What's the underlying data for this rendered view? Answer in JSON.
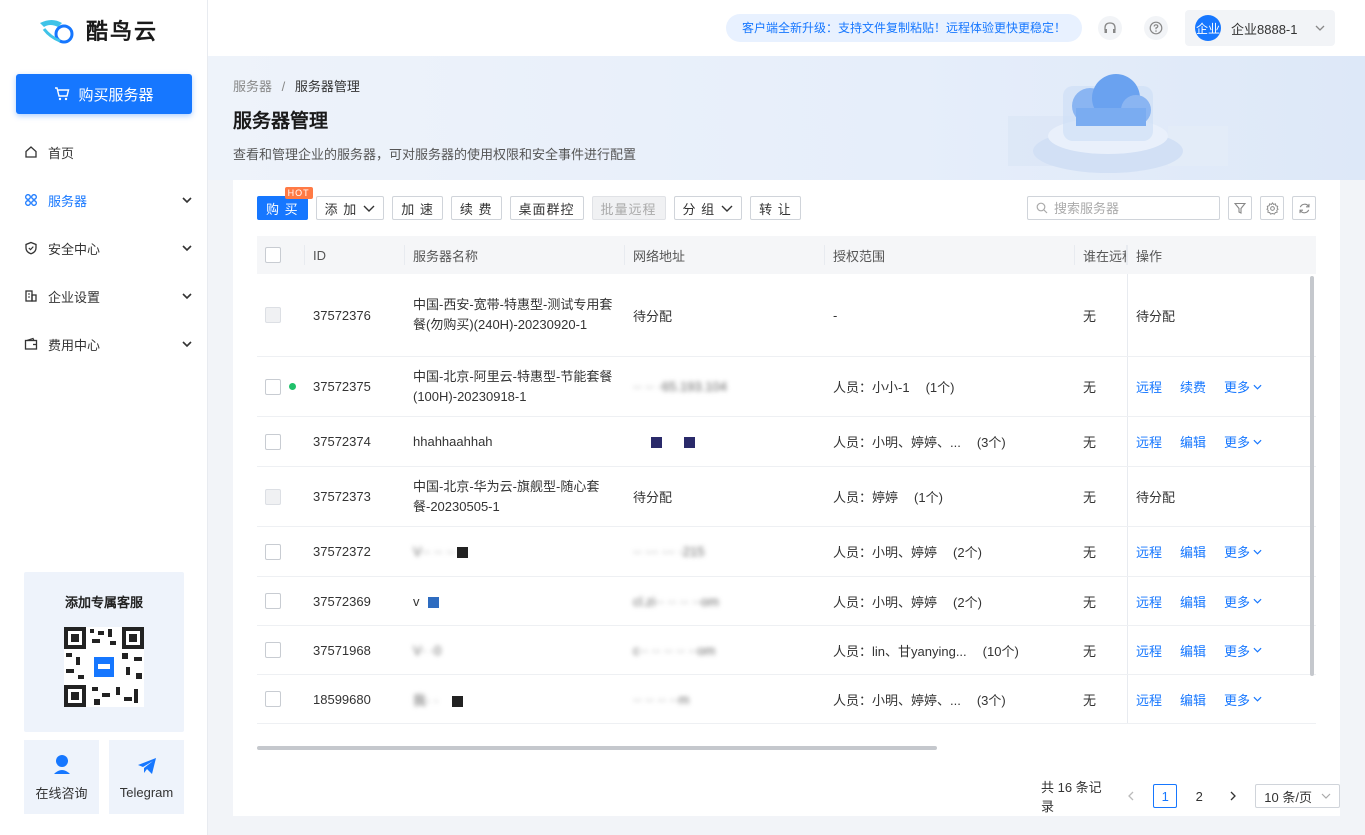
{
  "app": {
    "logo_text": "酷鸟云"
  },
  "sidebar": {
    "buy_button": "购买服务器",
    "items": [
      {
        "label": "首页",
        "icon": "home-icon",
        "expandable": false,
        "active": false
      },
      {
        "label": "服务器",
        "icon": "server-grid-icon",
        "expandable": true,
        "active": true
      },
      {
        "label": "安全中心",
        "icon": "shield-icon",
        "expandable": true,
        "active": false
      },
      {
        "label": "企业设置",
        "icon": "building-icon",
        "expandable": true,
        "active": false
      },
      {
        "label": "费用中心",
        "icon": "wallet-icon",
        "expandable": true,
        "active": false
      }
    ],
    "service_card_title": "添加专属客服",
    "online_consult": "在线咨询",
    "telegram": "Telegram"
  },
  "topbar": {
    "notice": "客户端全新升级：支持文件复制粘贴！远程体验更快更稳定！",
    "avatar_text": "企业",
    "user_name": "企业8888-1"
  },
  "header": {
    "breadcrumb_root": "服务器",
    "breadcrumb_sep": "/",
    "breadcrumb_current": "服务器管理",
    "title": "服务器管理",
    "description": "查看和管理企业的服务器，可对服务器的使用权限和安全事件进行配置"
  },
  "toolbar": {
    "buy": "购 买",
    "hot": "HOT",
    "add": "添 加",
    "accelerate": "加 速",
    "renew": "续 费",
    "desktop_control": "桌面群控",
    "batch_remote": "批量远程",
    "group": "分 组",
    "transfer": "转 让",
    "search_placeholder": "搜索服务器"
  },
  "table": {
    "headers": {
      "id": "ID",
      "name": "服务器名称",
      "network": "网络地址",
      "auth": "授权范围",
      "who": "谁在远程",
      "ops": "操作"
    },
    "rows": [
      {
        "id": "37572376",
        "name": "中国-西安-宽带-特惠型-测试专用套餐(勿购买)(240H)-20230920-1",
        "network": "待分配",
        "auth": "-",
        "auth_count": "",
        "who": "无",
        "ops": [
          "待分配"
        ],
        "online": false,
        "disabled": true
      },
      {
        "id": "37572375",
        "name": "中国-北京-阿里云-特惠型-节能套餐(100H)-20230918-1",
        "network": "·· ·· ·65.193.104",
        "auth": "人员：小小-1",
        "auth_count": "(1个)",
        "who": "无",
        "ops": [
          "远程",
          "续费",
          "更多"
        ],
        "online": true,
        "disabled": false
      },
      {
        "id": "37572374",
        "name": "hhahhaahhah",
        "network": "",
        "auth": "人员：小明、婷婷、...",
        "auth_count": "(3个)",
        "who": "无",
        "ops": [
          "远程",
          "编辑",
          "更多"
        ],
        "online": false,
        "disabled": false
      },
      {
        "id": "37572373",
        "name": "中国-北京-华为云-旗舰型-随心套餐-20230505-1",
        "network": "待分配",
        "auth": "人员：婷婷",
        "auth_count": "(1个)",
        "who": "无",
        "ops": [
          "待分配"
        ],
        "online": false,
        "disabled": true
      },
      {
        "id": "37572372",
        "name": "V·· ·· ··",
        "network": "·· ··· ··· ·215",
        "auth": "人员：小明、婷婷",
        "auth_count": "(2个)",
        "who": "无",
        "ops": [
          "远程",
          "编辑",
          "更多"
        ],
        "online": false,
        "disabled": false
      },
      {
        "id": "37572369",
        "name": "v",
        "network": "cl.zi·· ·· ·· ··om",
        "auth": "人员：小明、婷婷",
        "auth_count": "(2个)",
        "who": "无",
        "ops": [
          "远程",
          "编辑",
          "更多"
        ],
        "online": false,
        "disabled": false
      },
      {
        "id": "37571968",
        "name": "V· ·0",
        "network": "c·· ·· ·· ·· ··om",
        "auth": "人员：lin、甘yanying...",
        "auth_count": "(10个)",
        "who": "无",
        "ops": [
          "远程",
          "编辑",
          "更多"
        ],
        "online": false,
        "disabled": false
      },
      {
        "id": "18599680",
        "name": "我· ·",
        "network": "·· ·· ·· ··m",
        "auth": "人员：小明、婷婷、...",
        "auth_count": "(3个)",
        "who": "无",
        "ops": [
          "远程",
          "编辑",
          "更多"
        ],
        "online": false,
        "disabled": false
      }
    ]
  },
  "pagination": {
    "total": "共 16 条记录",
    "pages": [
      "1",
      "2"
    ],
    "current": "1",
    "page_size": "10 条/页"
  },
  "colors": {
    "primary": "#1677ff",
    "online": "#1fc06a",
    "hot": "#ff7a45"
  }
}
